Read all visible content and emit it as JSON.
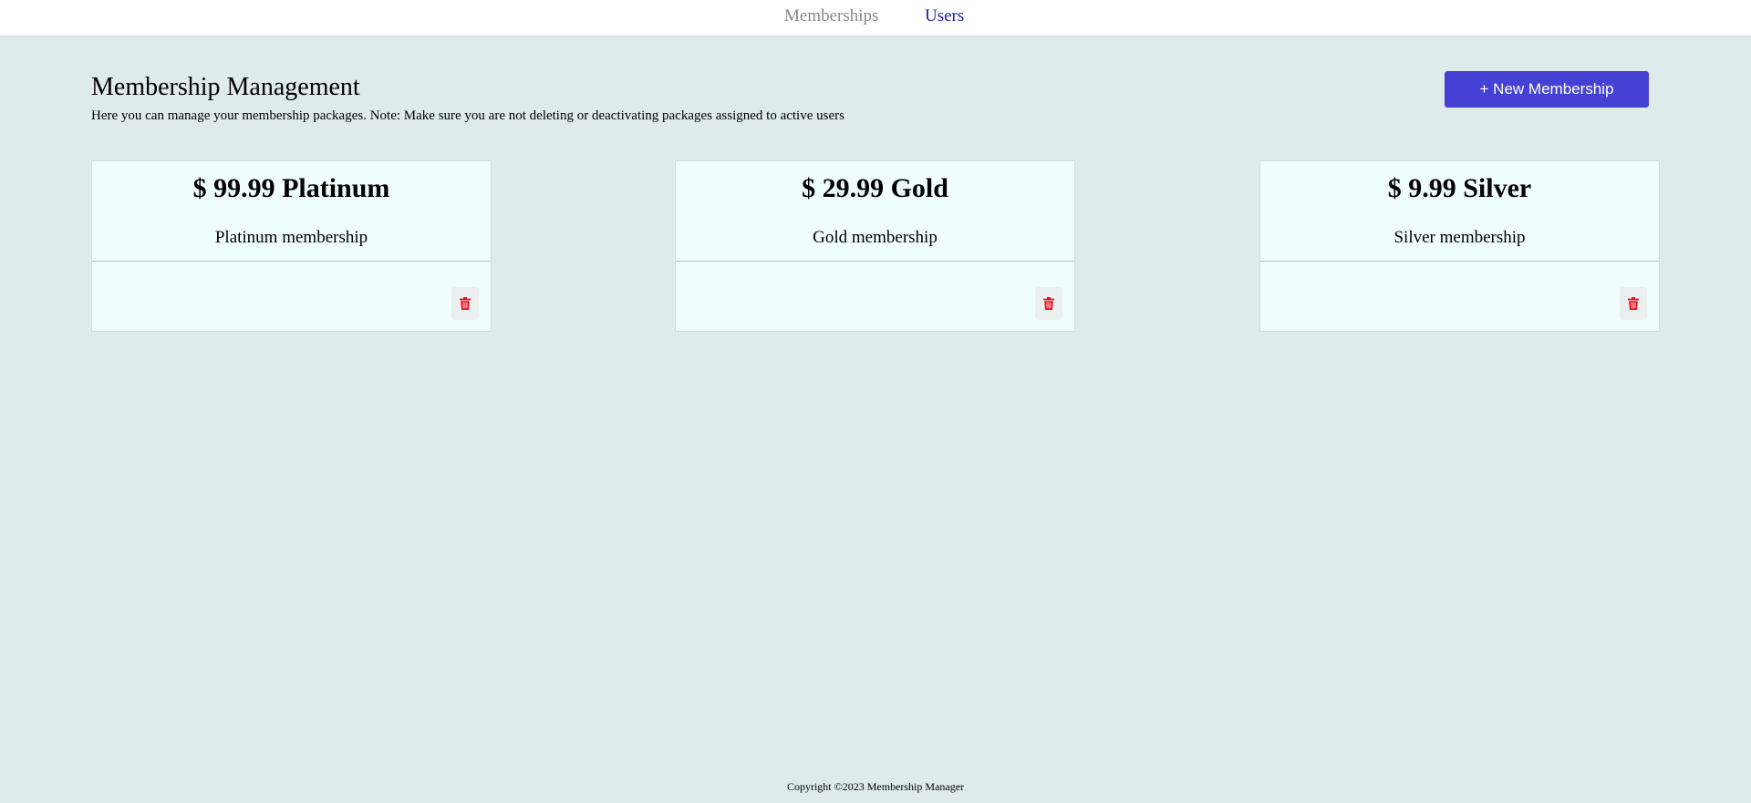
{
  "nav": {
    "items": [
      {
        "label": "Memberships",
        "color": "#888888"
      },
      {
        "label": "Users",
        "color": "#1a1aa6"
      }
    ]
  },
  "header": {
    "title": "Membership Management",
    "description": "Here you can manage your membership packages. Note: Make sure you are not deleting or deactivating packages assigned to active users"
  },
  "actions": {
    "new_membership_label": "+ New Membership",
    "new_membership_color": "#4541d4"
  },
  "memberships": [
    {
      "heading": "$ 99.99 Platinum",
      "description": "Platinum membership",
      "delete_icon": "trash-icon"
    },
    {
      "heading": "$ 29.99 Gold",
      "description": "Gold membership",
      "delete_icon": "trash-icon"
    },
    {
      "heading": "$ 9.99 Silver",
      "description": "Silver membership",
      "delete_icon": "trash-icon"
    }
  ],
  "colors": {
    "background": "#dfebeb",
    "card_background": "#effdfd",
    "delete_icon": "#e8111c"
  },
  "footer": {
    "copyright": "Copyright ©2023 Membership Manager"
  }
}
